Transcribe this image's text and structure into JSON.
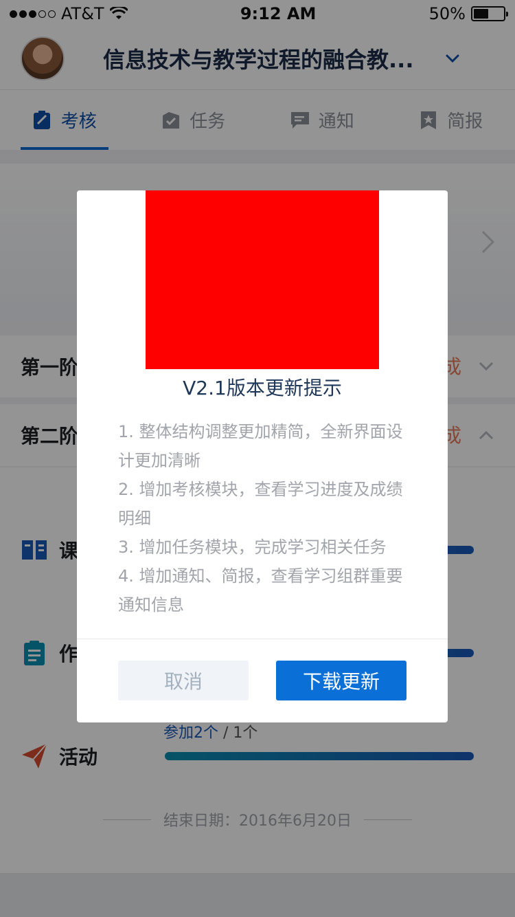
{
  "status_bar": {
    "carrier": "AT&T",
    "time": "9:12 AM",
    "battery": "50%",
    "battery_level": 0.5
  },
  "header": {
    "title": "信息技术与教学过程的融合教..."
  },
  "tabs": [
    {
      "label": "考核",
      "icon": "assessment-icon",
      "active": true
    },
    {
      "label": "任务",
      "icon": "task-icon",
      "active": false
    },
    {
      "label": "通知",
      "icon": "notice-icon",
      "active": false
    },
    {
      "label": "简报",
      "icon": "bulletin-icon",
      "active": false
    }
  ],
  "stages": [
    {
      "label": "第一阶",
      "stamp": "成"
    },
    {
      "label": "第二阶",
      "stamp": "成"
    }
  ],
  "stats": [
    {
      "label": "课",
      "icon": "course-icon"
    },
    {
      "label": "作",
      "icon": "homework-icon"
    },
    {
      "label": "活动",
      "icon": "activity-icon",
      "joined": "参加2个",
      "total": " / 1个"
    }
  ],
  "end_date": "结束日期：2016年6月20日",
  "modal": {
    "title": "V2.1版本更新提示",
    "notes": [
      "1. 整体结构调整更加精简，全新界面设计更加清晰",
      "2. 增加考核模块，查看学习进度及成绩明细",
      "3. 增加任务模块，完成学习相关任务",
      "4. 增加通知、简报，查看学习组群重要通知信息"
    ],
    "cancel_label": "取消",
    "download_label": "下载更新"
  },
  "colors": {
    "primary": "#0a6fd6",
    "title": "#1e3657",
    "image_placeholder": "#ff0000"
  }
}
